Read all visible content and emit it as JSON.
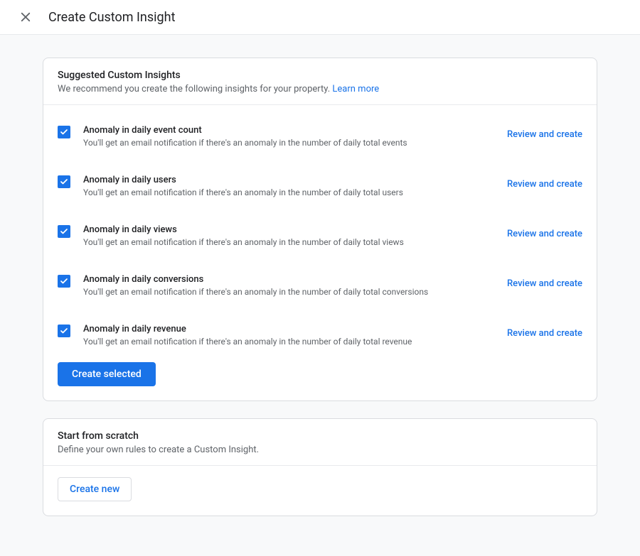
{
  "header": {
    "title": "Create Custom Insight"
  },
  "suggested": {
    "title": "Suggested Custom Insights",
    "subtitle": "We recommend you create the following insights for your property. ",
    "learn_more": "Learn more",
    "create_selected": "Create selected",
    "review_label": "Review and create",
    "items": [
      {
        "title": "Anomaly in daily event count",
        "desc": "You'll get an email notification if there's an anomaly in the number of daily total events",
        "checked": true
      },
      {
        "title": "Anomaly in daily users",
        "desc": "You'll get an email notification if there's an anomaly in the number of daily total users",
        "checked": true
      },
      {
        "title": "Anomaly in daily views",
        "desc": "You'll get an email notification if there's an anomaly in the number of daily total views",
        "checked": true
      },
      {
        "title": "Anomaly in daily conversions",
        "desc": "You'll get an email notification if there's an anomaly in the number of daily total conversions",
        "checked": true
      },
      {
        "title": "Anomaly in daily revenue",
        "desc": "You'll get an email notification if there's an anomaly in the number of daily total revenue",
        "checked": true
      }
    ]
  },
  "scratch": {
    "title": "Start from scratch",
    "subtitle": "Define your own rules to create a Custom Insight.",
    "create_new": "Create new"
  }
}
